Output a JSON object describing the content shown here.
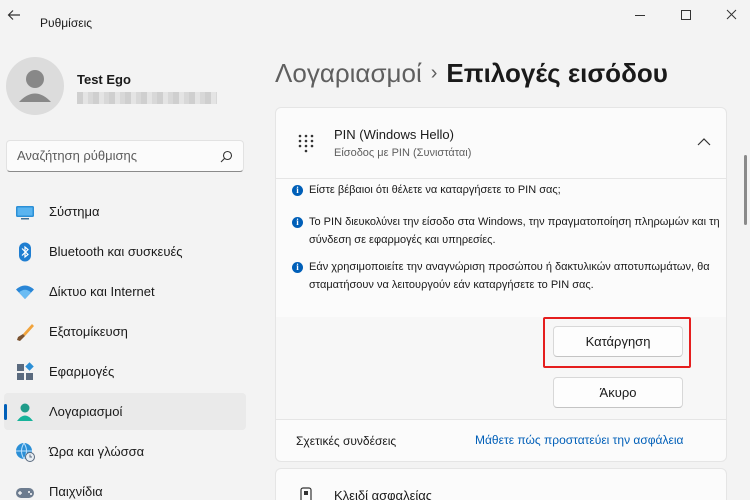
{
  "window": {
    "app_title": "Ρυθμίσεις",
    "back_label": "Πίσω"
  },
  "profile": {
    "name": "Test Ego"
  },
  "search": {
    "placeholder": "Αναζήτηση ρύθμισης"
  },
  "sidebar": {
    "items": [
      {
        "label": "Σύστημα",
        "icon": "system-icon"
      },
      {
        "label": "Bluetooth και συσκευές",
        "icon": "bluetooth-icon"
      },
      {
        "label": "Δίκτυο και Internet",
        "icon": "wifi-icon"
      },
      {
        "label": "Εξατομίκευση",
        "icon": "brush-icon"
      },
      {
        "label": "Εφαρμογές",
        "icon": "apps-icon"
      },
      {
        "label": "Λογαριασμοί",
        "icon": "accounts-icon",
        "active": true
      },
      {
        "label": "Ώρα και γλώσσα",
        "icon": "time-language-icon"
      },
      {
        "label": "Παιχνίδια",
        "icon": "gaming-icon"
      }
    ]
  },
  "header": {
    "parent": "Λογαριασμοί",
    "separator": "›",
    "current": "Επιλογές εισόδου"
  },
  "pin_card": {
    "title": "PIN (Windows Hello)",
    "subtitle": "Είσοδος με PIN (Συνιστάται)",
    "info": [
      "Είστε βέβαιοι ότι θέλετε να καταργήσετε το PIN σας;",
      "Το PIN διευκολύνει την είσοδο στα Windows, την πραγματοποίηση πληρωμών και τη σύνδεση σε εφαρμογές και υπηρεσίες.",
      "Εάν χρησιμοποιείτε την αναγνώριση προσώπου ή δακτυλικών αποτυπωμάτων, θα σταματήσουν να λειτουργούν εάν καταργήσετε το PIN σας."
    ],
    "remove_label": "Κατάργηση",
    "cancel_label": "Άκυρο",
    "related_label": "Σχετικές συνδέσεις",
    "related_link": "Μάθετε πώς προστατεύει την ασφάλεια"
  },
  "security_key_card": {
    "title": "Κλειδί ασφαλείας"
  },
  "colors": {
    "accent": "#005fb8",
    "highlight": "#e51e1e",
    "background": "#f3f3f3"
  }
}
